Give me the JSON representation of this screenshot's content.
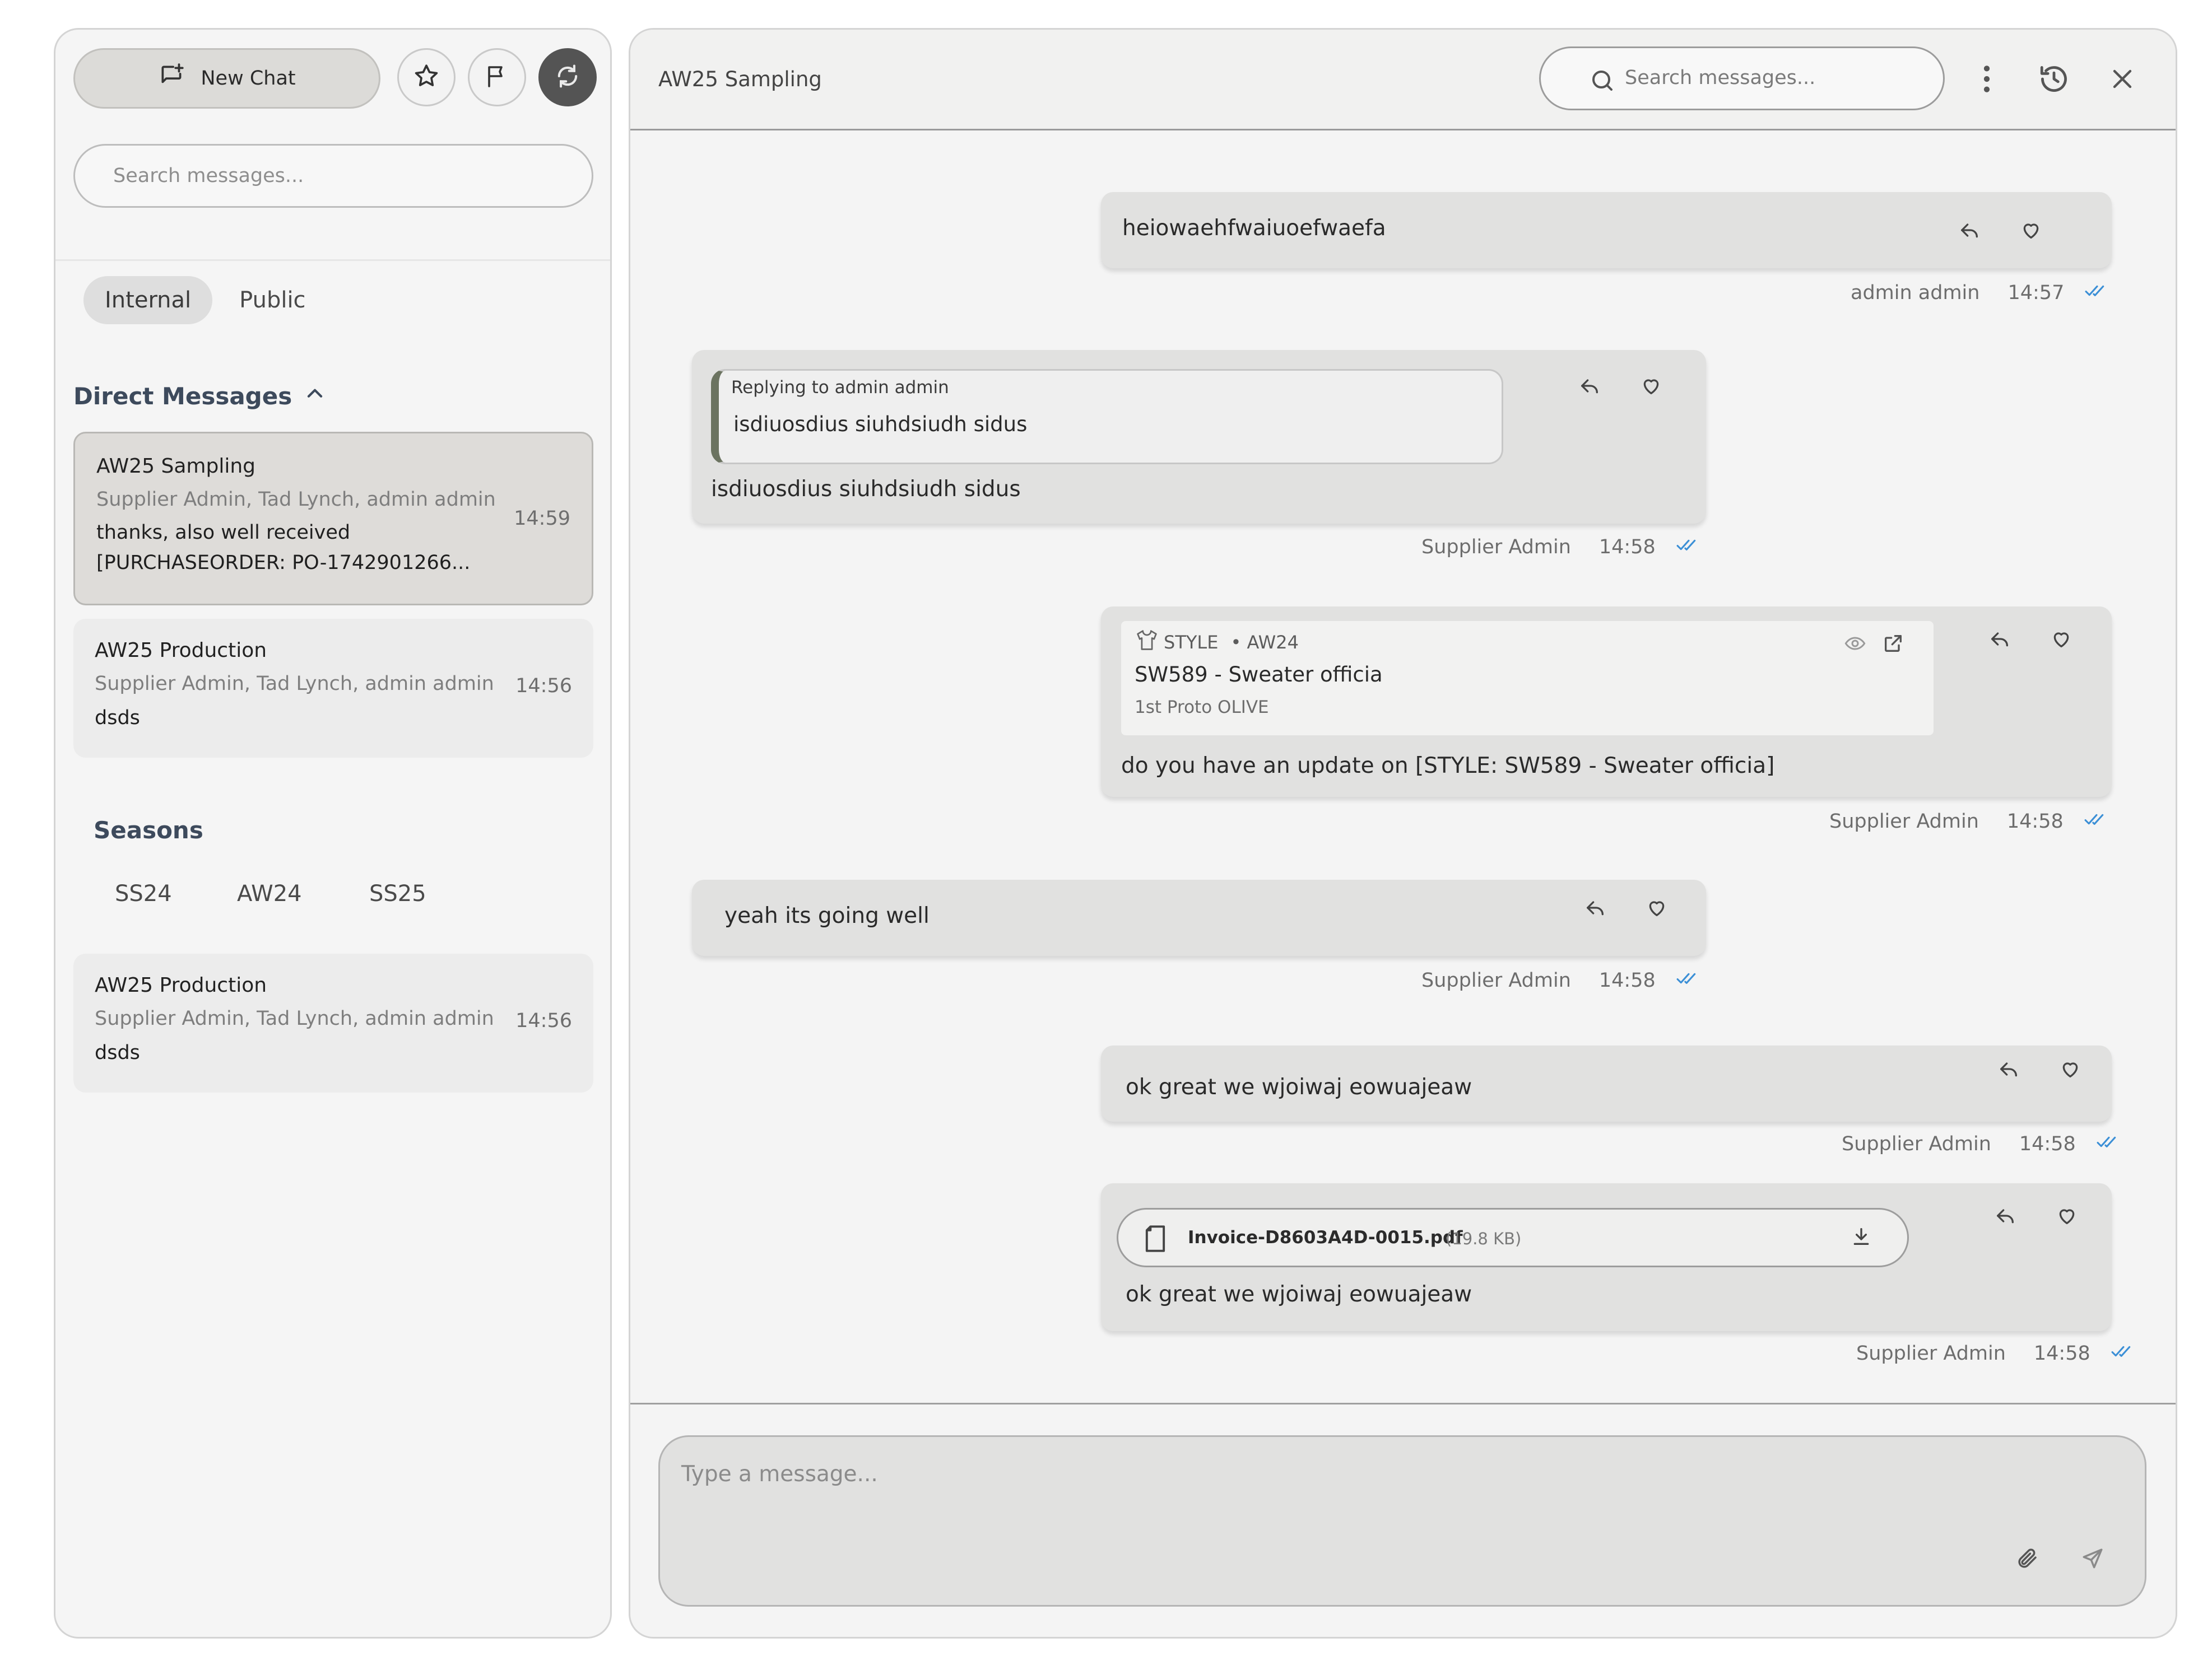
{
  "sidebar": {
    "new_chat_label": "New Chat",
    "search_placeholder": "Search messages...",
    "tabs": [
      {
        "label": "Internal",
        "active": true
      },
      {
        "label": "Public",
        "active": false
      }
    ],
    "direct_messages_label": "Direct Messages",
    "conversations": [
      {
        "title": "AW25 Sampling",
        "members": "Supplier Admin, Tad Lynch, admin admin",
        "snippet_line1": "thanks, also well received",
        "snippet_line2": "[PURCHASEORDER: PO-1742901266...",
        "time": "14:59",
        "selected": true
      },
      {
        "title": "AW25 Production",
        "members": "Supplier Admin, Tad Lynch, admin admin",
        "snippet_line1": "dsds",
        "time": "14:56",
        "selected": false
      }
    ],
    "seasons_label": "Seasons",
    "seasons": [
      "SS24",
      "AW24",
      "SS25"
    ],
    "season_conversation": {
      "title": "AW25 Production",
      "members": "Supplier Admin, Tad Lynch, admin admin",
      "snippet_line1": "dsds",
      "time": "14:56"
    }
  },
  "header": {
    "title": "AW25 Sampling",
    "search_placeholder": "Search messages..."
  },
  "messages": [
    {
      "text": "heiowaehfwaiuoefwaefa",
      "sender": "admin admin",
      "time": "14:57",
      "own": true
    },
    {
      "reply_label": "Replying to admin admin",
      "reply_text": "isdiuosdius siuhdsiudh sidus",
      "text": "isdiuosdius siuhdsiudh sidus",
      "sender": "Supplier Admin",
      "time": "14:58",
      "own": false
    },
    {
      "style_tag": "STYLE",
      "style_season": "• AW24",
      "style_name": "SW589 - Sweater officia",
      "style_sub": "1st Proto OLIVE",
      "text": "do you have an update on [STYLE: SW589 - Sweater officia]",
      "sender": "Supplier Admin",
      "time": "14:58",
      "own": true
    },
    {
      "text": "yeah its going well",
      "sender": "Supplier Admin",
      "time": "14:58",
      "own": false
    },
    {
      "text": "ok great we wjoiwaj eowuajeaw",
      "sender": "Supplier Admin",
      "time": "14:58",
      "own": true
    },
    {
      "file_name": "Invoice-D8603A4D-0015.pdf",
      "file_size": "(19.8 KB)",
      "text": "ok great we wjoiwaj eowuajeaw",
      "sender": "Supplier Admin",
      "time": "14:58",
      "own": true
    }
  ],
  "composer": {
    "placeholder": "Type a message..."
  },
  "icons": {
    "new_chat": "new-chat-icon",
    "star": "star-icon",
    "flag": "flag-icon",
    "refresh": "refresh-icon",
    "search": "search-icon",
    "more": "more-vertical-icon",
    "history": "history-icon",
    "close": "close-icon",
    "reply": "reply-icon",
    "heart": "heart-icon",
    "read": "double-check-icon",
    "attach": "paperclip-icon",
    "send": "send-icon"
  },
  "colors": {
    "read_receipt": "#3b8fd6",
    "accent_text": "#3d4a5c"
  }
}
